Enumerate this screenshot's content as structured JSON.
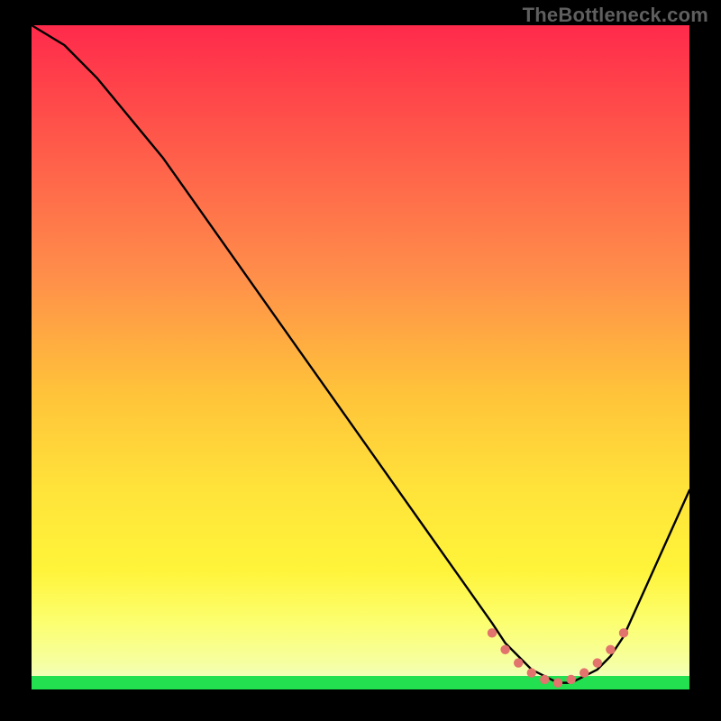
{
  "watermark": {
    "text": "TheBottleneck.com"
  },
  "chart_data": {
    "type": "line",
    "title": "",
    "xlabel": "",
    "ylabel": "",
    "xlim": [
      0,
      100
    ],
    "ylim": [
      0,
      100
    ],
    "grid": false,
    "legend": false,
    "colors": {
      "curve": "#000000",
      "markers": "#e2736d",
      "green_band": "#22e050",
      "gradient_top": "#ff2a4b",
      "gradient_mid_upper": "#ff8f4a",
      "gradient_mid": "#ffd23a",
      "gradient_mid_lower": "#fff43a",
      "gradient_lower": "#fcff70",
      "gradient_bottom": "#f6ffa0"
    },
    "series": [
      {
        "name": "bottleneck-curve",
        "x": [
          0,
          5,
          10,
          15,
          20,
          25,
          30,
          35,
          40,
          45,
          50,
          55,
          60,
          65,
          70,
          72,
          74,
          76,
          78,
          80,
          82,
          84,
          86,
          88,
          90,
          100
        ],
        "y": [
          100,
          97,
          92,
          86,
          80,
          73,
          66,
          59,
          52,
          45,
          38,
          31,
          24,
          17,
          10,
          7,
          5,
          3,
          2,
          1,
          1,
          2,
          3,
          5,
          8,
          30
        ]
      }
    ],
    "markers": {
      "name": "optimal-range-dots",
      "x": [
        70,
        72,
        74,
        76,
        78,
        80,
        82,
        84,
        86,
        88,
        90
      ],
      "y": [
        8.5,
        6.0,
        4.0,
        2.5,
        1.5,
        1.0,
        1.5,
        2.5,
        4.0,
        6.0,
        8.5
      ]
    }
  }
}
